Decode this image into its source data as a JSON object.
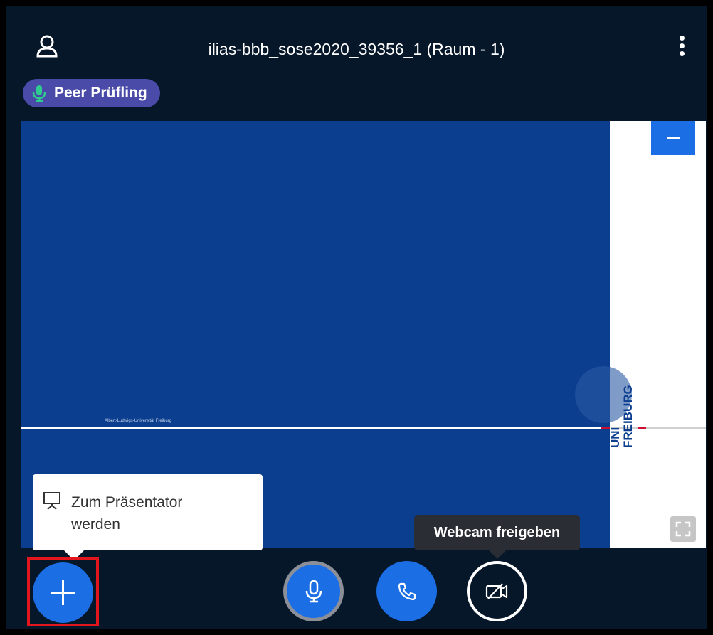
{
  "header": {
    "title": "ilias-bbb_sose2020_39356_1 (Raum - 1)"
  },
  "talking_indicator": {
    "name": "Peer Prüfling"
  },
  "presentation": {
    "institution_text": "Albert-Ludwigs-Universität Freiburg",
    "logo_line1": "UNI",
    "logo_line2": "FREIBURG",
    "accent_color": "#0b3e8f",
    "stripe_color": "#c8102e"
  },
  "actions_popup": {
    "items": [
      {
        "label": "Zum Präsentator werden",
        "icon": "presentation-icon"
      }
    ]
  },
  "tooltips": {
    "webcam": "Webcam freigeben"
  },
  "controls": {
    "actions_icon": "plus-icon",
    "mic_icon": "microphone-icon",
    "hangup_icon": "phone-icon",
    "webcam_icon": "video-off-icon"
  },
  "colors": {
    "background": "#06172a",
    "primary": "#1b6ee4",
    "talker_badge": "#4a4aa8",
    "highlight": "#e3161d"
  }
}
